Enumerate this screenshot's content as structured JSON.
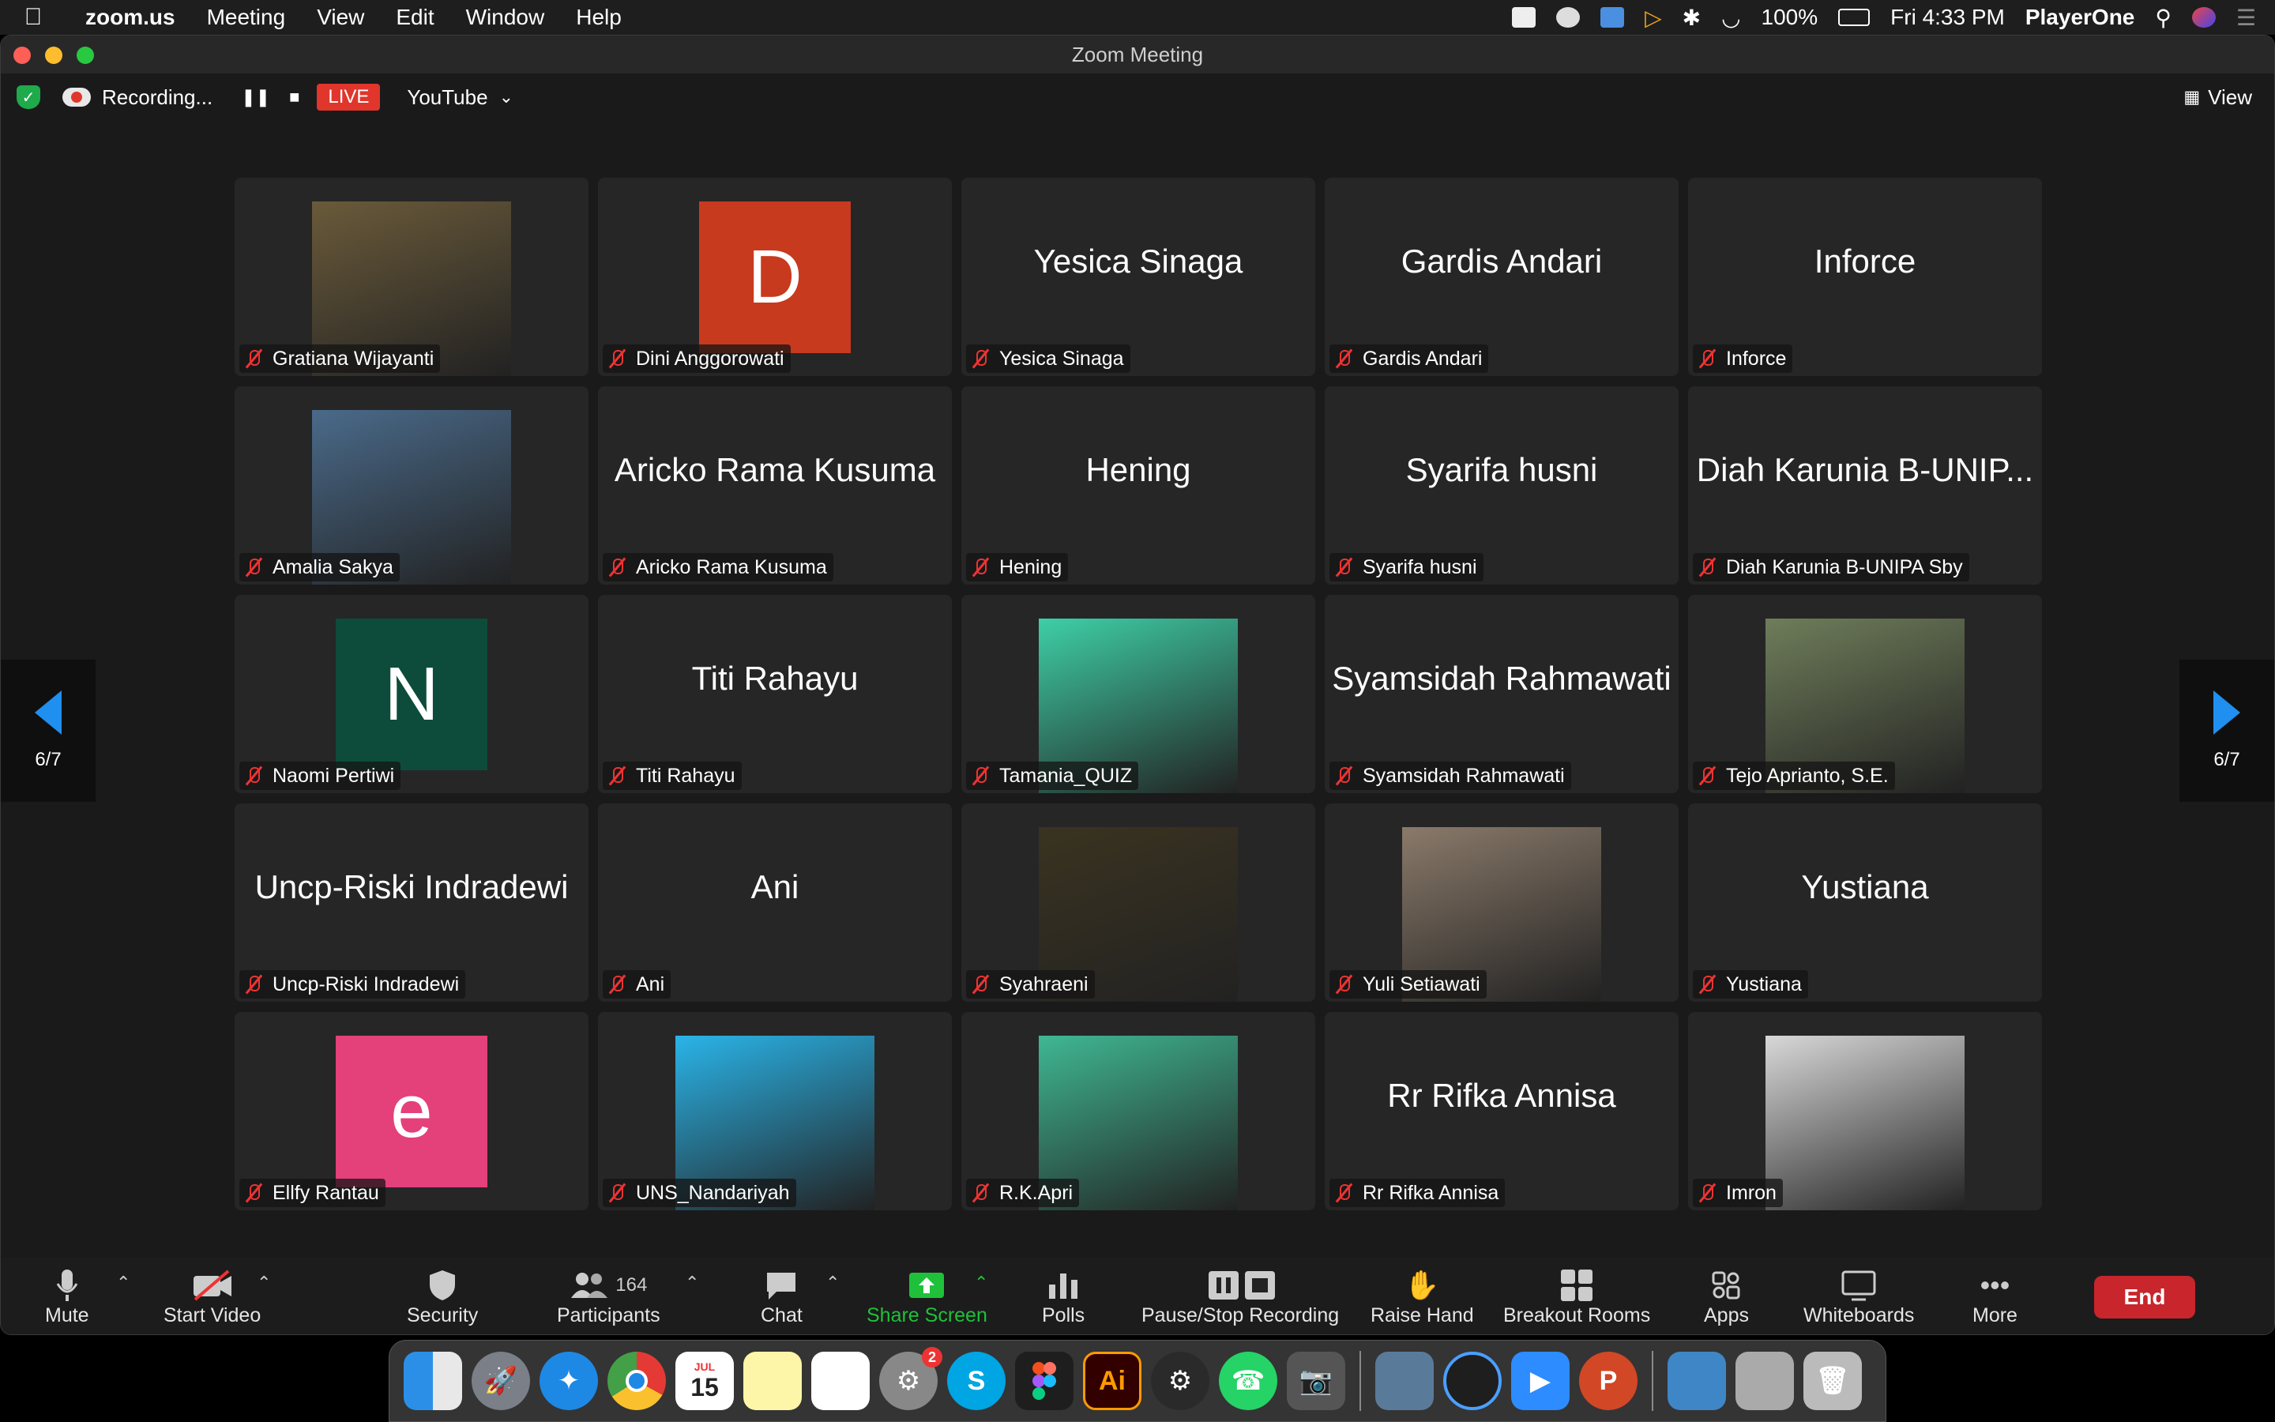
{
  "menubar": {
    "app": "zoom.us",
    "items": [
      "Meeting",
      "View",
      "Edit",
      "Window",
      "Help"
    ],
    "battery": "100%",
    "clock": "Fri 4:33 PM",
    "user": "PlayerOne"
  },
  "window": {
    "title": "Zoom Meeting"
  },
  "topbar": {
    "recording": "Recording...",
    "live": "LIVE",
    "stream": "YouTube",
    "view": "View"
  },
  "nav": {
    "page_left": "6/7",
    "page_right": "6/7"
  },
  "tiles": [
    {
      "name": "Gratiana Wijayanti",
      "kind": "photo",
      "photo": "woman-floral",
      "color": "#6a5a3a"
    },
    {
      "name": "Dini Anggorowati",
      "kind": "avatar",
      "letter": "D",
      "color": "#c73a1e"
    },
    {
      "name": "Yesica Sinaga",
      "kind": "text"
    },
    {
      "name": "Gardis Andari",
      "kind": "text"
    },
    {
      "name": "Inforce",
      "kind": "text"
    },
    {
      "name": "Amalia Sakya",
      "kind": "photo",
      "photo": "woman-harbor",
      "color": "#4a6a8a"
    },
    {
      "name": "Aricko Rama Kusuma",
      "kind": "text"
    },
    {
      "name": "Hening",
      "kind": "text"
    },
    {
      "name": "Syarifa husni",
      "kind": "text"
    },
    {
      "name": "Diah Karunia B-UNIPA Sby",
      "display": "Diah Karunia B-UNIP...",
      "kind": "text"
    },
    {
      "name": "Naomi Pertiwi",
      "kind": "avatar",
      "letter": "N",
      "color": "#0d4c3a"
    },
    {
      "name": "Titi Rahayu",
      "kind": "text"
    },
    {
      "name": "Tamania_QUIZ",
      "kind": "photo",
      "photo": "webinar-poster",
      "color": "#3ecfa6"
    },
    {
      "name": "Syamsidah Rahmawati",
      "kind": "text"
    },
    {
      "name": "Tejo Aprianto, S.E.",
      "kind": "photo",
      "photo": "man-with-child",
      "color": "#6f7d5a"
    },
    {
      "name": "Uncp-Riski Indradewi",
      "kind": "text"
    },
    {
      "name": "Ani",
      "kind": "text"
    },
    {
      "name": "Syahraeni",
      "kind": "photo",
      "photo": "sunset",
      "color": "#3a3320"
    },
    {
      "name": "Yuli Setiawati",
      "kind": "photo",
      "photo": "woman-orchids",
      "color": "#8a7a6a"
    },
    {
      "name": "Yustiana",
      "kind": "text"
    },
    {
      "name": "Ellfy Rantau",
      "kind": "avatar",
      "letter": "e",
      "color": "#e4407a"
    },
    {
      "name": "UNS_Nandariyah",
      "kind": "photo",
      "photo": "woman-blue-background",
      "color": "#2ab4e8"
    },
    {
      "name": "R.K.Apri",
      "kind": "photo",
      "photo": "woman-webinar-bg",
      "color": "#3fb792"
    },
    {
      "name": "Rr Rifka Annisa",
      "kind": "text"
    },
    {
      "name": "Imron",
      "kind": "photo",
      "photo": "man-suit",
      "color": "#d8d8d8"
    }
  ],
  "toolbar": {
    "mute": "Mute",
    "start_video": "Start Video",
    "security": "Security",
    "participants": "Participants",
    "participants_count": "164",
    "chat": "Chat",
    "share_screen": "Share Screen",
    "polls": "Polls",
    "pause_stop_recording": "Pause/Stop Recording",
    "raise_hand": "Raise Hand",
    "breakout_rooms": "Breakout Rooms",
    "apps": "Apps",
    "whiteboards": "Whiteboards",
    "more": "More",
    "end": "End"
  },
  "dock": {
    "calendar_month": "JUL",
    "calendar_day": "15",
    "settings_badge": "2",
    "illustrator": "Ai"
  },
  "colors": {
    "live_red": "#e0362c",
    "end_red": "#c8252c",
    "share_green": "#1fc13a",
    "nav_blue": "#1f8ff0"
  }
}
